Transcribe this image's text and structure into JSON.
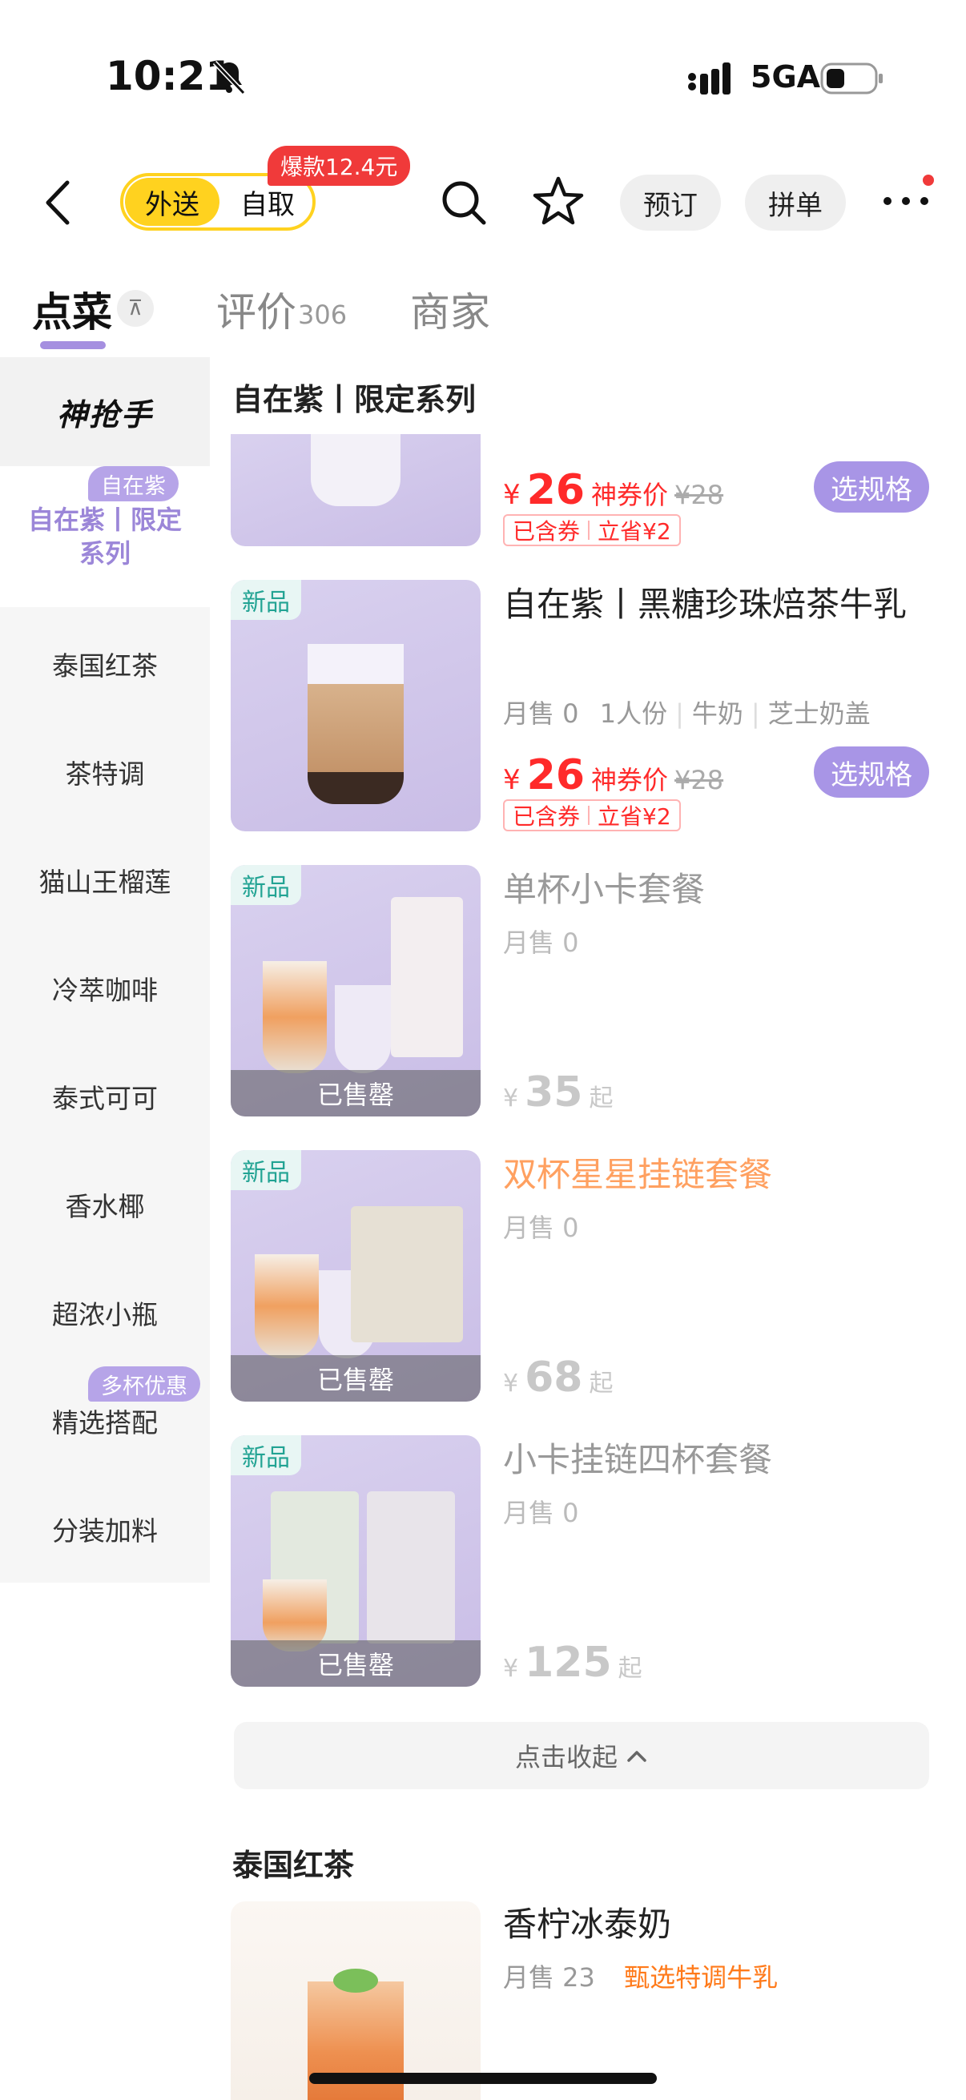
{
  "status_bar": {
    "time": "10:21",
    "network": "5GA"
  },
  "nav": {
    "mode_delivery": "外送",
    "mode_pickup": "自取",
    "hot_badge": "爆款12.4元",
    "reserve_label": "预订",
    "group_label": "拼单"
  },
  "tabs": {
    "order": "点菜",
    "pin_icon": "⊼",
    "reviews": "评价",
    "reviews_count": "306",
    "shop": "商家"
  },
  "sidebar": {
    "logo": "神抢手",
    "active": {
      "label": "自在紫丨限定系列",
      "tag": "自在紫"
    },
    "items": [
      {
        "label": "泰国红茶"
      },
      {
        "label": "茶特调"
      },
      {
        "label": "猫山王榴莲"
      },
      {
        "label": "冷萃咖啡"
      },
      {
        "label": "泰式可可"
      },
      {
        "label": "香水椰"
      },
      {
        "label": "超浓小瓶"
      },
      {
        "label": "精选搭配",
        "tag": "多杯优惠"
      },
      {
        "label": "分装加料"
      }
    ]
  },
  "content": {
    "section1_title": "自在紫丨限定系列",
    "partial_item": {
      "currency": "¥",
      "price": "26",
      "price_label": "神券价",
      "orig_price": "¥28",
      "coupon_a": "已含券",
      "coupon_b": "立省¥2",
      "spec_button": "选规格"
    },
    "products": [
      {
        "new_tag": "新品",
        "name": "自在紫丨黑糖珍珠焙茶牛乳",
        "sales": "月售 0",
        "serving": "1人份",
        "attr1": "牛奶",
        "attr2": "芝士奶盖",
        "currency": "¥",
        "price": "26",
        "price_label": "神券价",
        "orig_price": "¥28",
        "coupon_a": "已含券",
        "coupon_b": "立省¥2",
        "spec_button": "选规格"
      },
      {
        "new_tag": "新品",
        "name": "单杯小卡套餐",
        "sales": "月售 0",
        "currency": "¥",
        "price": "35",
        "suffix": "起",
        "sold_out": "已售罄"
      },
      {
        "new_tag": "新品",
        "name": "双杯星星挂链套餐",
        "sales": "月售 0",
        "currency": "¥",
        "price": "68",
        "suffix": "起",
        "sold_out": "已售罄"
      },
      {
        "new_tag": "新品",
        "name": "小卡挂链四杯套餐",
        "sales": "月售 0",
        "currency": "¥",
        "price": "125",
        "suffix": "起",
        "sold_out": "已售罄"
      }
    ],
    "collapse_label": "点击收起",
    "section2_title": "泰国红茶",
    "thai_item": {
      "name": "香柠冰泰奶",
      "sales": "月售 23",
      "highlight": "甄选特调牛乳"
    }
  },
  "colors": {
    "accent": "#a895e6",
    "price": "#ff2a2a",
    "brand_yellow": "#ffd21f"
  }
}
